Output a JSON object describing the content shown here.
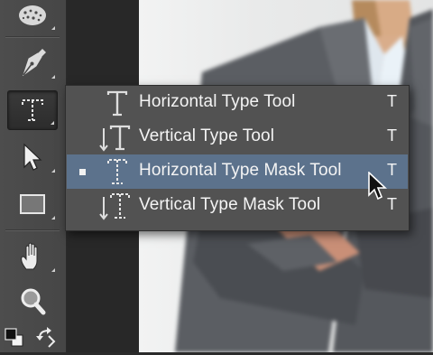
{
  "toolbar": {
    "tools": [
      {
        "name": "sponge-tool",
        "icon": "sponge-icon"
      },
      {
        "name": "pen-tool",
        "icon": "pen-icon"
      },
      {
        "name": "type-tool",
        "icon": "type-icon",
        "active": true
      },
      {
        "name": "path-selection-tool",
        "icon": "arrow-icon"
      },
      {
        "name": "rectangle-tool",
        "icon": "rectangle-icon"
      },
      {
        "name": "hand-tool",
        "icon": "hand-icon"
      },
      {
        "name": "zoom-tool",
        "icon": "zoom-icon"
      },
      {
        "name": "default-colors",
        "icon": "default-colors-icon"
      },
      {
        "name": "swap-colors",
        "icon": "swap-arrows-icon"
      }
    ]
  },
  "flyout": {
    "items": [
      {
        "label": "Horizontal Type Tool",
        "shortcut": "T",
        "icon": "horizontal-type-icon",
        "selected": false
      },
      {
        "label": "Vertical Type Tool",
        "shortcut": "T",
        "icon": "vertical-type-icon",
        "selected": false
      },
      {
        "label": "Horizontal Type Mask Tool",
        "shortcut": "T",
        "icon": "horizontal-type-mask-icon",
        "selected": true
      },
      {
        "label": "Vertical Type Mask Tool",
        "shortcut": "T",
        "icon": "vertical-type-mask-icon",
        "selected": false
      }
    ]
  },
  "colors": {
    "panel": "#4a4a4a",
    "menu": "#525252",
    "highlight": "#5c728c",
    "text": "#f4f4f4"
  }
}
